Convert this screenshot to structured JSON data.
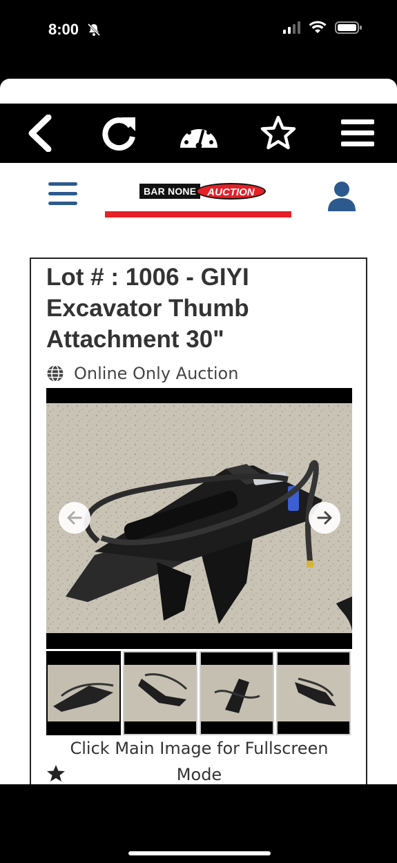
{
  "status_bar": {
    "time": "8:00",
    "icons": [
      "bell-slash-icon",
      "cellular-signal-icon",
      "wifi-icon",
      "battery-icon"
    ]
  },
  "browser_toolbar": {
    "buttons": [
      {
        "name": "back",
        "icon": "chevron-left-icon"
      },
      {
        "name": "reload",
        "icon": "reload-icon"
      },
      {
        "name": "dashboard",
        "icon": "speedometer-icon"
      },
      {
        "name": "favorite",
        "icon": "star-outline-icon"
      },
      {
        "name": "menu",
        "icon": "hamburger-icon"
      }
    ]
  },
  "site_header": {
    "logo_left": "BAR NONE",
    "logo_right": "AUCTION",
    "colors": {
      "brand_red": "#e52127",
      "brand_blue": "#2d5a8e"
    }
  },
  "lot": {
    "title": "Lot # : 1006 - GIYI Excavator Thumb Attachment 30\"",
    "auction_type": "Online Only Auction",
    "fullscreen_hint": "Click Main Image for Fullscreen Mode",
    "thumbnail_count": 4
  }
}
